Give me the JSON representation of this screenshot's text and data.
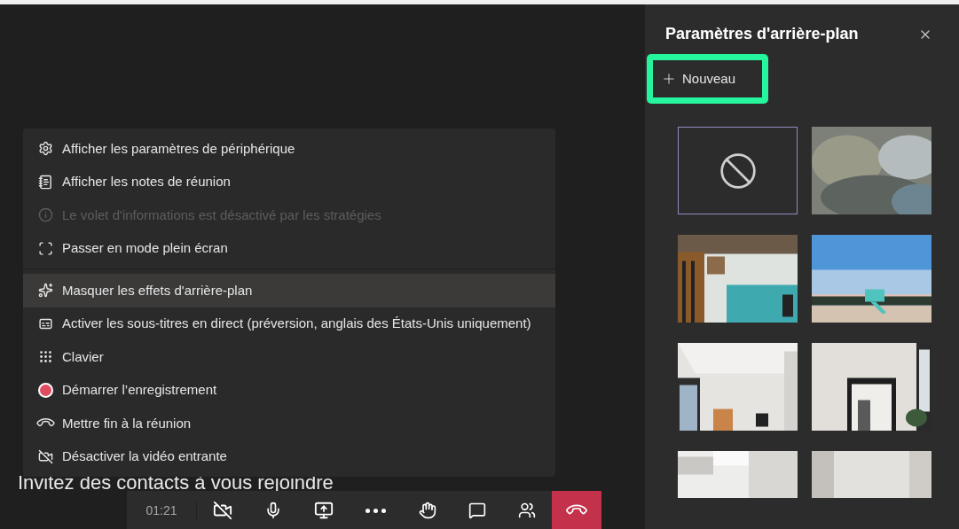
{
  "menu": {
    "items": [
      {
        "kind": "settings",
        "label": "Afficher les paramètres de périphérique",
        "disabled": false,
        "selected": false
      },
      {
        "kind": "notes",
        "label": "Afficher les notes de réunion",
        "disabled": false,
        "selected": false
      },
      {
        "kind": "info",
        "label": "Le volet d'informations est désactivé par les stratégies",
        "disabled": true,
        "selected": false
      },
      {
        "kind": "fullscreen",
        "label": "Passer en mode plein écran",
        "disabled": false,
        "selected": false
      },
      {
        "kind": "effects",
        "label": "Masquer les effets d'arrière-plan",
        "disabled": false,
        "selected": true
      },
      {
        "kind": "captions",
        "label": "Activer les sous-titres en direct (préversion, anglais des États-Unis uniquement)",
        "disabled": false,
        "selected": false
      },
      {
        "kind": "keypad",
        "label": "Clavier",
        "disabled": false,
        "selected": false
      },
      {
        "kind": "record",
        "label": "Démarrer l’enregistrement",
        "disabled": false,
        "selected": false
      },
      {
        "kind": "end",
        "label": "Mettre fin à la réunion",
        "disabled": false,
        "selected": false
      },
      {
        "kind": "video",
        "label": "Désactiver la vidéo entrante",
        "disabled": false,
        "selected": false
      }
    ]
  },
  "invite_text": "Invitez des contacts à vous rejoindre",
  "toolbar": {
    "timer": "01:21"
  },
  "panel": {
    "title": "Paramètres d'arrière-plan",
    "new_button": "Nouveau",
    "backgrounds": [
      {
        "kind": "none",
        "selected": true
      },
      {
        "kind": "picture",
        "selected": false
      },
      {
        "kind": "picture",
        "selected": false
      },
      {
        "kind": "picture",
        "selected": false
      },
      {
        "kind": "picture",
        "selected": false
      },
      {
        "kind": "picture",
        "selected": false
      },
      {
        "kind": "picture",
        "selected": false
      },
      {
        "kind": "picture",
        "selected": false
      }
    ]
  }
}
